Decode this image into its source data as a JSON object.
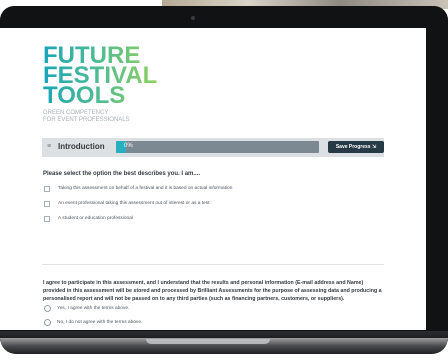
{
  "logo": {
    "line1": "FUTURE",
    "line2": "FESTIVAL",
    "line3": "TOOLS"
  },
  "tagline": {
    "line1": "GREEN COMPETENCY",
    "line2": "FOR EVENT PROFESSIONALS"
  },
  "section": {
    "menu_icon": "menu-icon",
    "title": "Introduction",
    "progress_label": "0%",
    "progress_value": 0.05,
    "save_label": "Save Progress ⇲"
  },
  "question": {
    "prompt": "Please select the option the best describes you. I am....",
    "options": [
      "Taking this assessment on behalf of a festival and it is based on actual information",
      "An event professional taking this assessment out of interest or as a test",
      "A student or education professional"
    ]
  },
  "consent": {
    "text": "I agree to participate in this assessment, and I understand that the results and personal information (E-mail address and Name) provided in this assessment will be stored and processed by Brilliant Assessments for the purpose of assessing data and producing a personalised report and will not be passed on to any third parties (such as financing partners, customers, or suppliers).",
    "options": [
      "Yes, I agree with the terms above.",
      "No, I do not agree with the terms above."
    ]
  },
  "colors": {
    "accent": "#28b0bf",
    "dark_button": "#263a46",
    "logo_start": "#1aa6b7",
    "logo_end": "#8fd15d",
    "bezel": "#111214"
  }
}
